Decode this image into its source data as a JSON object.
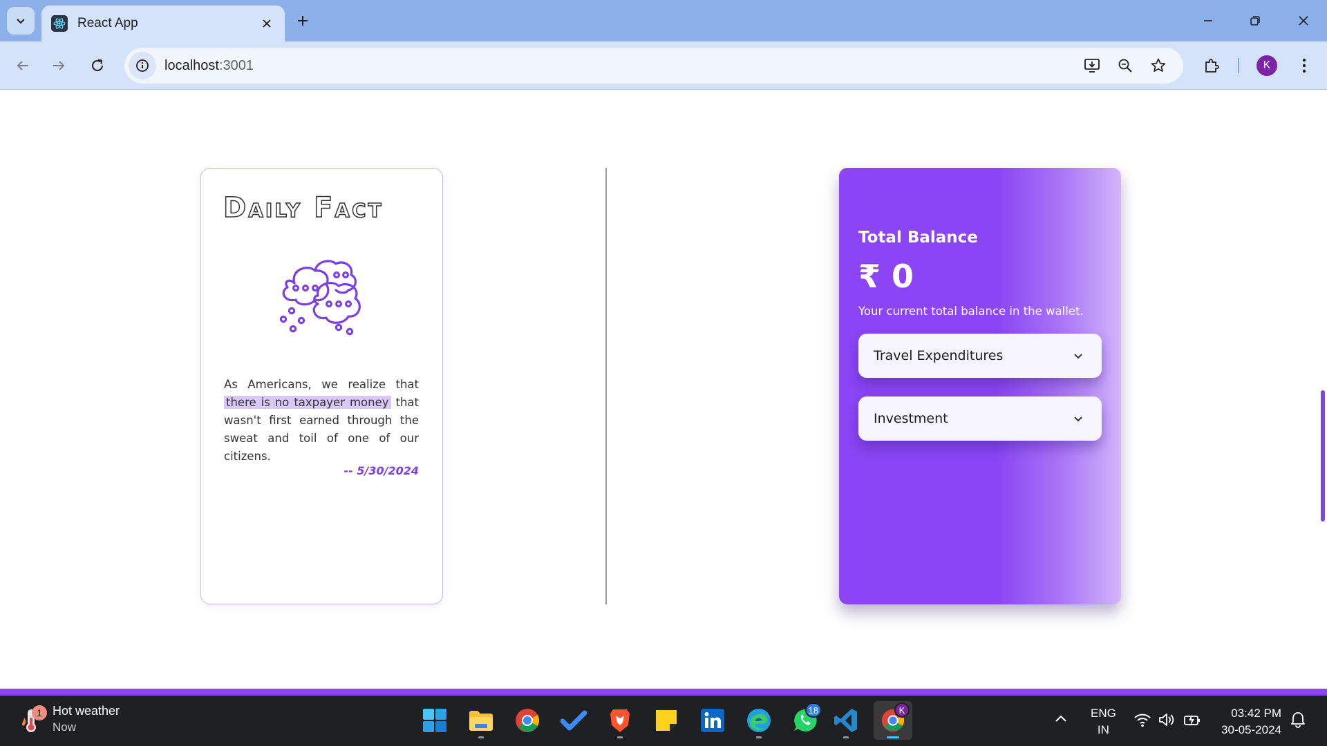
{
  "browser": {
    "tab_title": "React App",
    "url_host": "localhost",
    "url_port": ":3001",
    "profile_initial": "K"
  },
  "daily_fact": {
    "title": "Daily Fact",
    "text_before": "As Americans, we realize that ",
    "text_highlight": "there is no taxpayer money",
    "text_after": " that wasn't first earned through the sweat and toil of one of our citizens.",
    "date": "-- 5/30/2024"
  },
  "wallet": {
    "label": "Total Balance",
    "amount": "₹ 0",
    "description": "Your current total balance in the wallet.",
    "dropdowns": [
      {
        "label": "Travel Expenditures"
      },
      {
        "label": "Investment"
      }
    ]
  },
  "taskbar": {
    "weather_title": "Hot weather",
    "weather_sub": "Now",
    "weather_badge": "1",
    "whatsapp_badge": "18",
    "chrome_profile": "K",
    "lang_top": "ENG",
    "lang_bottom": "IN",
    "time": "03:42 PM",
    "date": "30-05-2024"
  },
  "colors": {
    "accent": "#8b45f4",
    "tabbar": "#8bb0e9",
    "toolbar": "#d4e3fa"
  }
}
